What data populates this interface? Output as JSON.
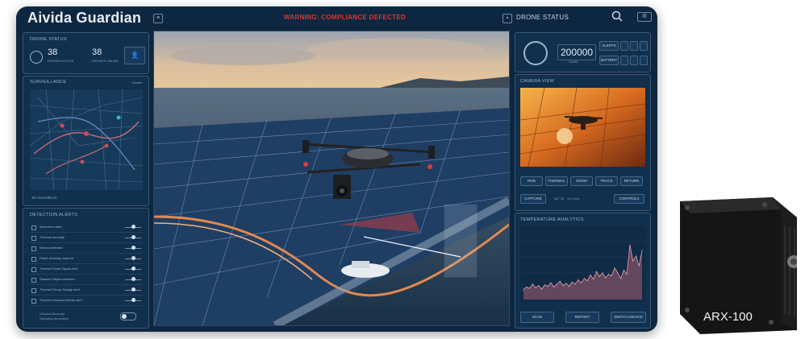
{
  "app": {
    "title": "Aivida Guardian"
  },
  "header": {
    "warning": "WARNING: COMPLIANCE DEFECTED",
    "drone_status_title": "DRONE STATUS"
  },
  "drone_summary": {
    "title": "DRONE STATUS",
    "stat1_value": "38",
    "stat1_label": "DRONES ACTIVE",
    "stat2_value": "38",
    "stat2_label": "DRONES ONLINE"
  },
  "map": {
    "title": "SURVEILLANCE",
    "details": "Details",
    "footer": "3D Surveillance"
  },
  "alerts": {
    "title": "DETECTION ALERTS",
    "items": [
      "Movement alert",
      "Thermal anomaly",
      "Motion detected",
      "Panel cleaning required",
      "Thermal Panel Signal alert",
      "Shadow Object detected",
      "Thermal Group Outage alert",
      "Thermal Unusual Activity alert"
    ],
    "footer_line1": "Unusual Anomaly",
    "footer_line2": "Operating Boundary"
  },
  "drone_panel": {
    "counter_value": "200000",
    "counter_label": "Scans",
    "grid_labels": [
      "ALERTS",
      "BATTERY"
    ],
    "camera_title": "CAMERA VIEW",
    "cam_buttons": [
      "RGB",
      "THERMAL",
      "ZOOM",
      "TRACK",
      "RETURN"
    ],
    "cam_row2_left": "CAPTURE",
    "cam_row2_right": "CONTROLS",
    "cam_row2_mid": "ALT 31 · 12.4 m/s"
  },
  "chart": {
    "title": "TEMPERATURE ANALYTICS",
    "buttons": [
      "SCAN",
      "REPORT",
      "SWITCH DEVICE"
    ]
  },
  "chart_data": {
    "type": "area",
    "title": "TEMPERATURE ANALYTICS",
    "xlabel": "",
    "ylabel": "",
    "x": [
      1,
      2,
      3,
      4,
      5,
      6,
      7,
      8,
      9,
      10,
      11,
      12,
      13,
      14,
      15,
      16,
      17,
      18,
      19,
      20,
      21,
      22,
      23,
      24,
      25,
      26,
      27,
      28,
      29,
      30,
      31,
      32,
      33,
      34,
      35,
      36,
      37,
      38,
      39,
      40
    ],
    "values": [
      14,
      18,
      16,
      22,
      17,
      20,
      15,
      21,
      19,
      24,
      18,
      22,
      26,
      20,
      23,
      19,
      25,
      22,
      28,
      24,
      30,
      27,
      35,
      29,
      40,
      33,
      38,
      31,
      36,
      34,
      45,
      38,
      30,
      42,
      36,
      78,
      55,
      62,
      48,
      70
    ],
    "ylim": [
      0,
      100
    ]
  },
  "device": {
    "label": "ARX-100"
  },
  "colors": {
    "bg": "#0e2740",
    "panel": "#10304d",
    "accent": "#c76a7a",
    "warning": "#e0342b"
  }
}
